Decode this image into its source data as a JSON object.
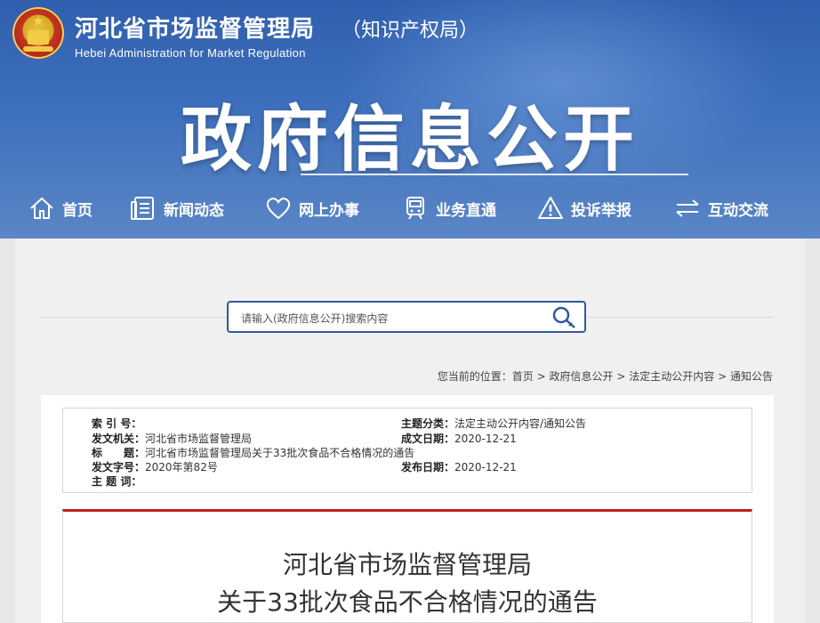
{
  "header": {
    "title": "河北省市场监督管理局",
    "subtitle": "（知识产权局）",
    "english": "Hebei Administration for Market Regulation",
    "banner": "政府信息公开"
  },
  "nav": [
    {
      "label": "首页",
      "icon": "home-icon"
    },
    {
      "label": "新闻动态",
      "icon": "news-icon"
    },
    {
      "label": "网上办事",
      "icon": "heart-icon"
    },
    {
      "label": "业务直通",
      "icon": "train-icon"
    },
    {
      "label": "投诉举报",
      "icon": "warning-icon"
    },
    {
      "label": "互动交流",
      "icon": "exchange-icon"
    }
  ],
  "search": {
    "placeholder": "请输入(政府信息公开)搜索内容",
    "value": ""
  },
  "breadcrumb": {
    "prefix": "您当前的位置：",
    "items": [
      "首页",
      "政府信息公开",
      "法定主动公开内容",
      "通知公告"
    ],
    "separator": ">"
  },
  "meta": {
    "index_label": "索 引 号：",
    "index_value": "",
    "issuer_label": "发文机关：",
    "issuer_value": "河北省市场监督管理局",
    "title_label": "标　　题：",
    "title_value": "河北省市场监督管理局关于33批次食品不合格情况的通告",
    "docno_label": "发文字号：",
    "docno_value": "2020年第82号",
    "keywords_label": "主 题 词：",
    "keywords_value": "",
    "category_label": "主题分类：",
    "category_value": "法定主动公开内容/通知公告",
    "created_label": "成文日期：",
    "created_value": "2020-12-21",
    "published_label": "发布日期：",
    "published_value": "2020-12-21"
  },
  "article": {
    "title_line1": "河北省市场监督管理局",
    "title_line2": "关于33批次食品不合格情况的通告"
  },
  "colors": {
    "header_blue": "#3e6fbc",
    "search_border": "#2f5aa0",
    "accent_red": "#c01d1d"
  }
}
